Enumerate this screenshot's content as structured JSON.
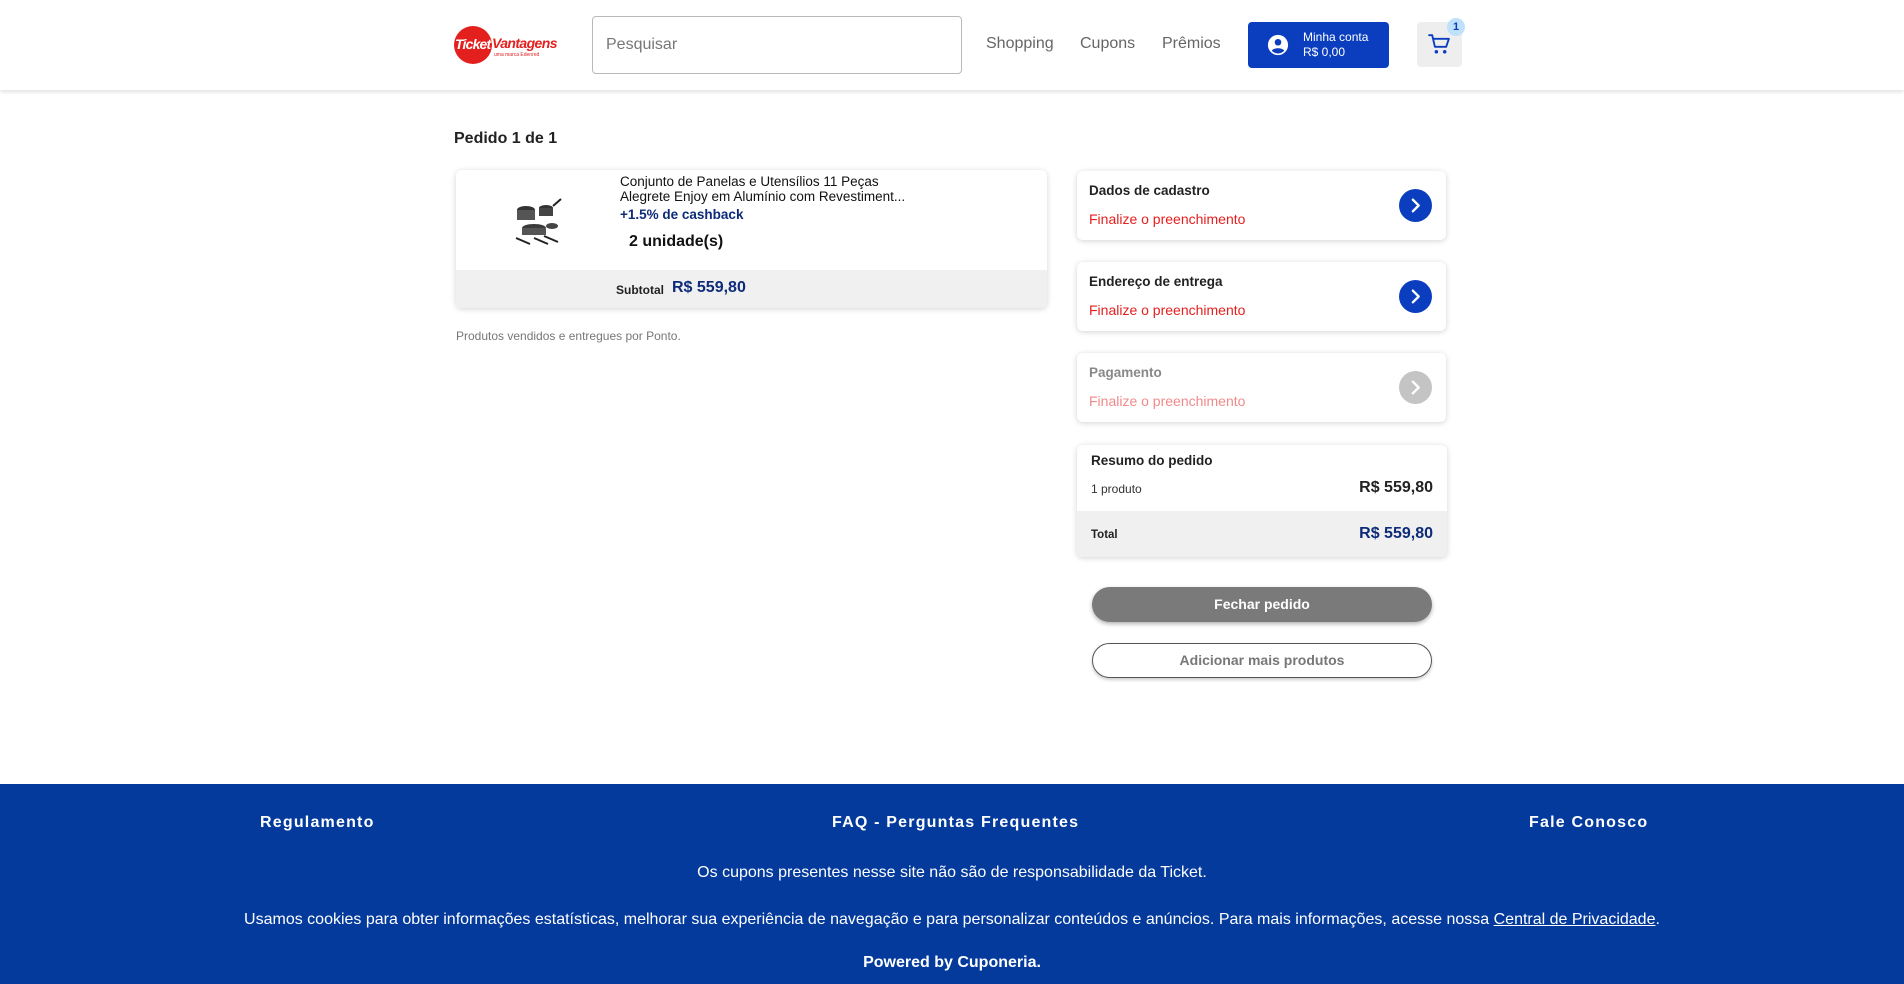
{
  "header": {
    "logo": {
      "brand": "Ticket Vantagens",
      "brand_part1": "Ticket",
      "brand_part2": "Vantagens",
      "tagline": "uma marca Edenred",
      "brand_color": "#e4201f"
    },
    "search": {
      "placeholder": "Pesquisar",
      "value": ""
    },
    "nav": {
      "shopping": "Shopping",
      "cupons": "Cupons",
      "premios": "Prêmios"
    },
    "account": {
      "label": "Minha conta",
      "balance": "R$ 0,00",
      "icon": "account-circle-icon",
      "color": "#0a3ebf"
    },
    "cart": {
      "count": "1",
      "icon": "cart-icon"
    }
  },
  "order": {
    "title": "Pedido 1 de 1",
    "product": {
      "name": "Conjunto de Panelas e Utensílios 11 Peças Alegrete Enjoy em Alumínio com Revestiment...",
      "cashback": "+1.5% de cashback",
      "quantity": "2 unidade(s)",
      "subtotal_label": "Subtotal",
      "subtotal_value": "R$ 559,80"
    },
    "seller_note": "Produtos vendidos e entregues por Ponto."
  },
  "steps": [
    {
      "title": "Dados de cadastro",
      "status": "Finalize o preenchimento",
      "enabled": true
    },
    {
      "title": "Endereço de entrega",
      "status": "Finalize o preenchimento",
      "enabled": true
    },
    {
      "title": "Pagamento",
      "status": "Finalize o preenchimento",
      "enabled": false
    }
  ],
  "summary": {
    "title": "Resumo do pedido",
    "count_label": "1 produto",
    "count_value": "R$ 559,80",
    "total_label": "Total",
    "total_value": "R$ 559,80"
  },
  "actions": {
    "close_order": "Fechar pedido",
    "add_more": "Adicionar mais produtos"
  },
  "footer": {
    "links": {
      "regulamento": "Regulamento",
      "faq": "FAQ - Perguntas Frequentes",
      "fale": "Fale Conosco"
    },
    "disclaimer": "Os cupons presentes nesse site não são de responsabilidade da Ticket.",
    "cookies_text": "Usamos cookies para obter informações estatísticas, melhorar sua experiência de navegação e para personalizar conteúdos e anúncios. Para mais informações, acesse nossa",
    "privacy_link": "Central de Privacidade",
    "powered": "Powered by Cuponeria.",
    "color": "#033a9c"
  }
}
